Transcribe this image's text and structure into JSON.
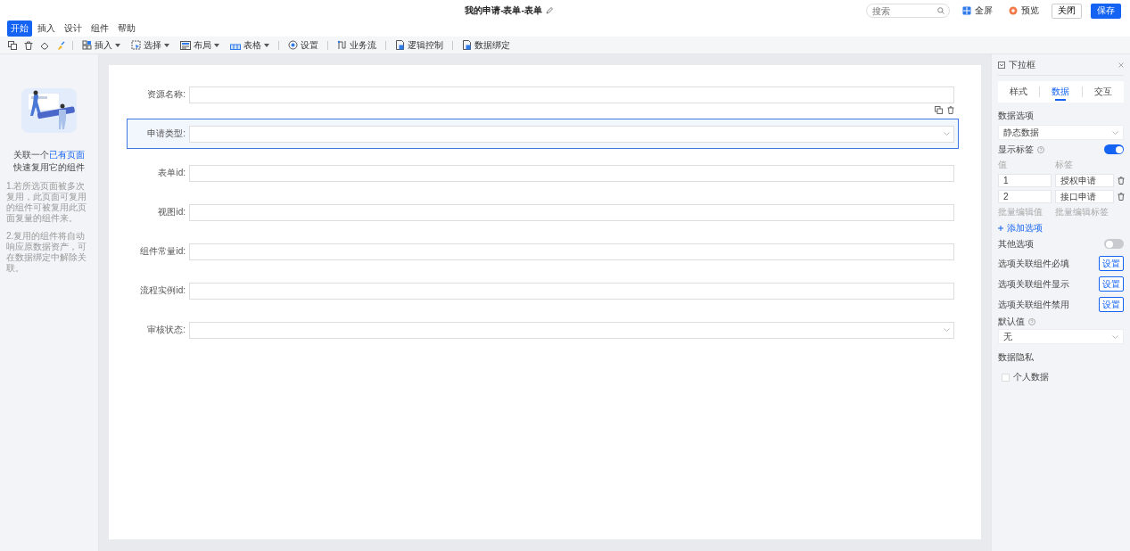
{
  "header": {
    "title": "我的申请-表单-表单",
    "search": {
      "placeholder": "搜索"
    },
    "actions": [
      {
        "kind": "fullscreen",
        "label": "全屏"
      },
      {
        "kind": "preview",
        "label": "预览"
      },
      {
        "kind": "close",
        "label": "关闭"
      },
      {
        "kind": "save",
        "label": "保存"
      }
    ],
    "menu_tabs": [
      {
        "label": "开始",
        "selected": true
      },
      {
        "label": "插入",
        "selected": false
      },
      {
        "label": "设计",
        "selected": false
      },
      {
        "label": "组件",
        "selected": false
      },
      {
        "label": "帮助",
        "selected": false
      }
    ]
  },
  "toolbar": {
    "items": [
      {
        "kind": "insert",
        "label": "插入",
        "dropdown": true
      },
      {
        "kind": "select",
        "label": "选择",
        "dropdown": true
      },
      {
        "kind": "layout",
        "label": "布局",
        "dropdown": true
      },
      {
        "kind": "table",
        "label": "表格",
        "dropdown": true
      },
      {
        "kind": "settings",
        "label": "设置",
        "dropdown": false
      },
      {
        "kind": "flow",
        "label": "业务流",
        "dropdown": false
      },
      {
        "kind": "logic",
        "label": "逻辑控制",
        "dropdown": false
      },
      {
        "kind": "binding",
        "label": "数据绑定",
        "dropdown": false
      }
    ]
  },
  "left_panel": {
    "prompt_prefix": "关联一个",
    "prompt_link": "已有页面",
    "prompt_line2": "快速复用它的组件",
    "notes": [
      "1.若所选页面被多次复用，此页面可复用的组件可被复用此页面复量的组件来。",
      "2.复用的组件将自动响应原数据资产，可在数据绑定中解除关联。"
    ]
  },
  "form": {
    "fields": [
      {
        "label": "资源名称:",
        "kind": "input",
        "selected": false
      },
      {
        "label": "申请类型:",
        "kind": "select",
        "selected": true
      },
      {
        "label": "表单id:",
        "kind": "input",
        "selected": false
      },
      {
        "label": "视图id:",
        "kind": "input",
        "selected": false
      },
      {
        "label": "组件常量id:",
        "kind": "input",
        "selected": false
      },
      {
        "label": "流程实例id:",
        "kind": "input",
        "selected": false
      },
      {
        "label": "审核状态:",
        "kind": "select",
        "selected": false
      }
    ]
  },
  "properties": {
    "title": "下拉框",
    "tabs": [
      {
        "label": "样式",
        "selected": false
      },
      {
        "label": "数据",
        "selected": true
      },
      {
        "label": "交互",
        "selected": false
      }
    ],
    "data_options_label": "数据选项",
    "data_source": "静态数据",
    "show_label": {
      "label": "显示标签",
      "on": true
    },
    "value_header": "值",
    "label_header": "标签",
    "options": [
      {
        "value": "1",
        "label": "授权申请"
      },
      {
        "value": "2",
        "label": "接口申请"
      }
    ],
    "batch_links": [
      "批量编辑值",
      "批量编辑标签"
    ],
    "add_option": "添加选项",
    "other_option": {
      "label": "其他选项",
      "on": false
    },
    "link_settings": [
      {
        "label": "选项关联组件必填",
        "button": "设置"
      },
      {
        "label": "选项关联组件显示",
        "button": "设置"
      },
      {
        "label": "选项关联组件禁用",
        "button": "设置"
      }
    ],
    "default_label": "默认值",
    "default_value": "无",
    "privacy_label": "数据隐私",
    "personal_data": {
      "label": "个人数据",
      "checked": false
    }
  }
}
